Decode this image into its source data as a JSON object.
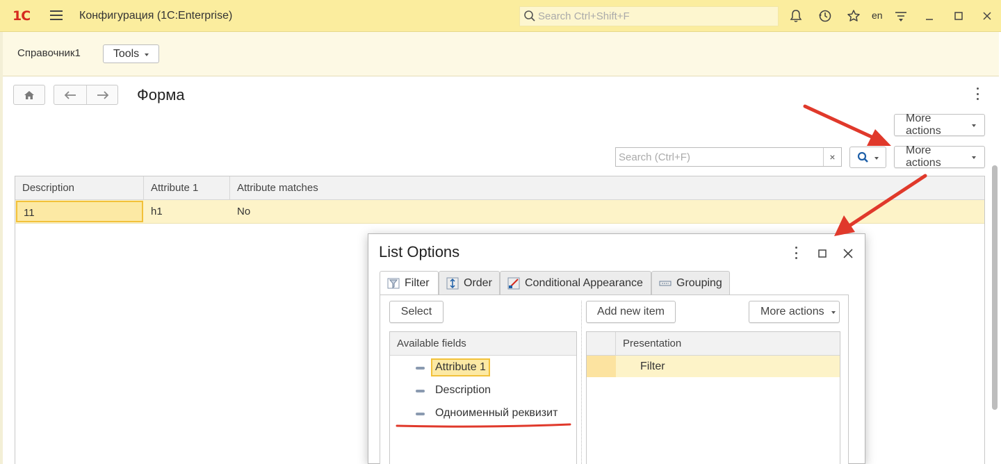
{
  "titlebar": {
    "logo": "1С",
    "title": "Конфигурация  (1С:Enterprise)",
    "search_placeholder": "Search Ctrl+Shift+F",
    "language": "en",
    "icons": [
      "bell-icon",
      "history-icon",
      "star-icon",
      "menu-funnel-icon",
      "minimize-icon",
      "maximize-icon",
      "close-icon"
    ]
  },
  "sectionbar": {
    "section_name": "Справочник1",
    "tools_label": "Tools"
  },
  "form": {
    "title": "Форма",
    "more_actions_top": "More actions",
    "more_actions_list": "More actions",
    "search_placeholder": "Search (Ctrl+F)",
    "clear_label": "×"
  },
  "table": {
    "columns": [
      "Description",
      "Attribute 1",
      "Attribute matches"
    ],
    "rows": [
      [
        "11",
        "h1",
        "No"
      ]
    ]
  },
  "dialog": {
    "title": "List Options",
    "tabs": [
      {
        "label": "Filter",
        "icon": "filter-icon"
      },
      {
        "label": "Order",
        "icon": "order-icon"
      },
      {
        "label": "Conditional Appearance",
        "icon": "appearance-icon"
      },
      {
        "label": "Grouping",
        "icon": "grouping-icon"
      }
    ],
    "select_label": "Select",
    "add_new_item_label": "Add new item",
    "more_actions_label": "More actions",
    "available_fields_header": "Available fields",
    "fields": [
      "Attribute 1",
      "Description",
      "Одноименный реквизит"
    ],
    "presentation_header": "Presentation",
    "presentation_rows": [
      "Filter"
    ]
  },
  "colors": {
    "titlebar": "#fbed9e",
    "accent_red": "#e0392b",
    "selection": "#fce9a4",
    "selection_border": "#f2c13a"
  }
}
